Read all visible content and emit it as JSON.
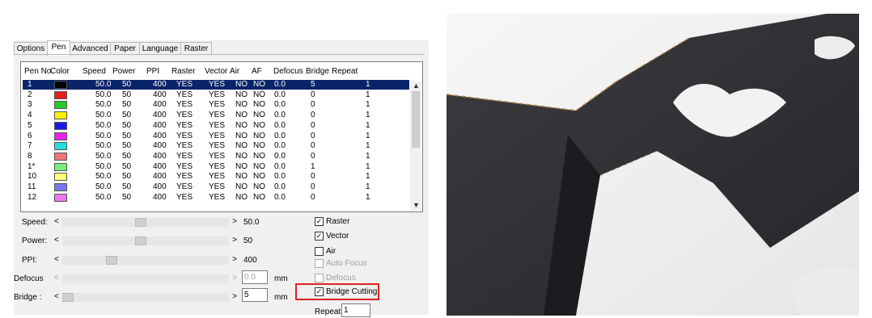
{
  "tabs": [
    "Options",
    "Pen",
    "Advanced",
    "Paper",
    "Language",
    "Raster"
  ],
  "active_tab": "Pen",
  "table": {
    "headers": [
      "Pen No.",
      "Color",
      "Speed",
      "Power",
      "PPI",
      "Raster",
      "Vector",
      "Air",
      "AF",
      "Defocus",
      "Bridge",
      "Repeat"
    ],
    "rows": [
      {
        "pen": "1",
        "color": "#000000",
        "speed": "50.0",
        "power": "50",
        "ppi": "400",
        "raster": "YES",
        "vector": "YES",
        "air": "NO",
        "af": "NO",
        "defocus": "0.0",
        "bridge": "5",
        "repeat": "1"
      },
      {
        "pen": "2",
        "color": "#e81c1c",
        "speed": "50.0",
        "power": "50",
        "ppi": "400",
        "raster": "YES",
        "vector": "YES",
        "air": "NO",
        "af": "NO",
        "defocus": "0.0",
        "bridge": "0",
        "repeat": "1"
      },
      {
        "pen": "3",
        "color": "#22cc22",
        "speed": "50.0",
        "power": "50",
        "ppi": "400",
        "raster": "YES",
        "vector": "YES",
        "air": "NO",
        "af": "NO",
        "defocus": "0.0",
        "bridge": "0",
        "repeat": "1"
      },
      {
        "pen": "4",
        "color": "#ffee00",
        "speed": "50.0",
        "power": "50",
        "ppi": "400",
        "raster": "YES",
        "vector": "YES",
        "air": "NO",
        "af": "NO",
        "defocus": "0.0",
        "bridge": "0",
        "repeat": "1"
      },
      {
        "pen": "5",
        "color": "#1a1ae6",
        "speed": "50.0",
        "power": "50",
        "ppi": "400",
        "raster": "YES",
        "vector": "YES",
        "air": "NO",
        "af": "NO",
        "defocus": "0.0",
        "bridge": "0",
        "repeat": "1"
      },
      {
        "pen": "6",
        "color": "#ee22ee",
        "speed": "50.0",
        "power": "50",
        "ppi": "400",
        "raster": "YES",
        "vector": "YES",
        "air": "NO",
        "af": "NO",
        "defocus": "0.0",
        "bridge": "0",
        "repeat": "1"
      },
      {
        "pen": "7",
        "color": "#22dddd",
        "speed": "50.0",
        "power": "50",
        "ppi": "400",
        "raster": "YES",
        "vector": "YES",
        "air": "NO",
        "af": "NO",
        "defocus": "0.0",
        "bridge": "0",
        "repeat": "1"
      },
      {
        "pen": "8",
        "color": "#ee7777",
        "speed": "50.0",
        "power": "50",
        "ppi": "400",
        "raster": "YES",
        "vector": "YES",
        "air": "NO",
        "af": "NO",
        "defocus": "0.0",
        "bridge": "0",
        "repeat": "1"
      },
      {
        "pen": "1*",
        "color": "#77ee77",
        "speed": "50.0",
        "power": "50",
        "ppi": "400",
        "raster": "YES",
        "vector": "YES",
        "air": "NO",
        "af": "NO",
        "defocus": "0.0",
        "bridge": "1",
        "repeat": "1"
      },
      {
        "pen": "10",
        "color": "#ffff77",
        "speed": "50.0",
        "power": "50",
        "ppi": "400",
        "raster": "YES",
        "vector": "YES",
        "air": "NO",
        "af": "NO",
        "defocus": "0.0",
        "bridge": "0",
        "repeat": "1"
      },
      {
        "pen": "11",
        "color": "#7777ee",
        "speed": "50.0",
        "power": "50",
        "ppi": "400",
        "raster": "YES",
        "vector": "YES",
        "air": "NO",
        "af": "NO",
        "defocus": "0.0",
        "bridge": "0",
        "repeat": "1"
      },
      {
        "pen": "12",
        "color": "#ee77ee",
        "speed": "50.0",
        "power": "50",
        "ppi": "400",
        "raster": "YES",
        "vector": "YES",
        "air": "NO",
        "af": "NO",
        "defocus": "0.0",
        "bridge": "0",
        "repeat": "1"
      }
    ]
  },
  "controls": {
    "speed": {
      "label": "Speed:",
      "value": "50.0",
      "level": 0.5
    },
    "power": {
      "label": "Power:",
      "value": "50",
      "level": 0.5
    },
    "ppi": {
      "label": "PPI:",
      "value": "400",
      "level": 0.3
    },
    "defocus": {
      "label": "Defocus",
      "value": "0.0",
      "unit": "mm"
    },
    "bridge": {
      "label": "Bridge :",
      "value": "5",
      "unit": "mm"
    },
    "arrow_left": "<",
    "arrow_right": ">"
  },
  "checkboxes": {
    "raster": "Raster",
    "vector": "Vector",
    "air": "Air",
    "auto_focus": "Auto Focus",
    "defocus": "Defocus",
    "bridge_cutting": "Bridge Cutting",
    "check_mark": "✓"
  },
  "repeat": {
    "label": "Repeat:",
    "value": "1"
  },
  "colors": {
    "selection": "#0a246a",
    "highlight_box": "#e02020",
    "material": "#2e2e32"
  }
}
